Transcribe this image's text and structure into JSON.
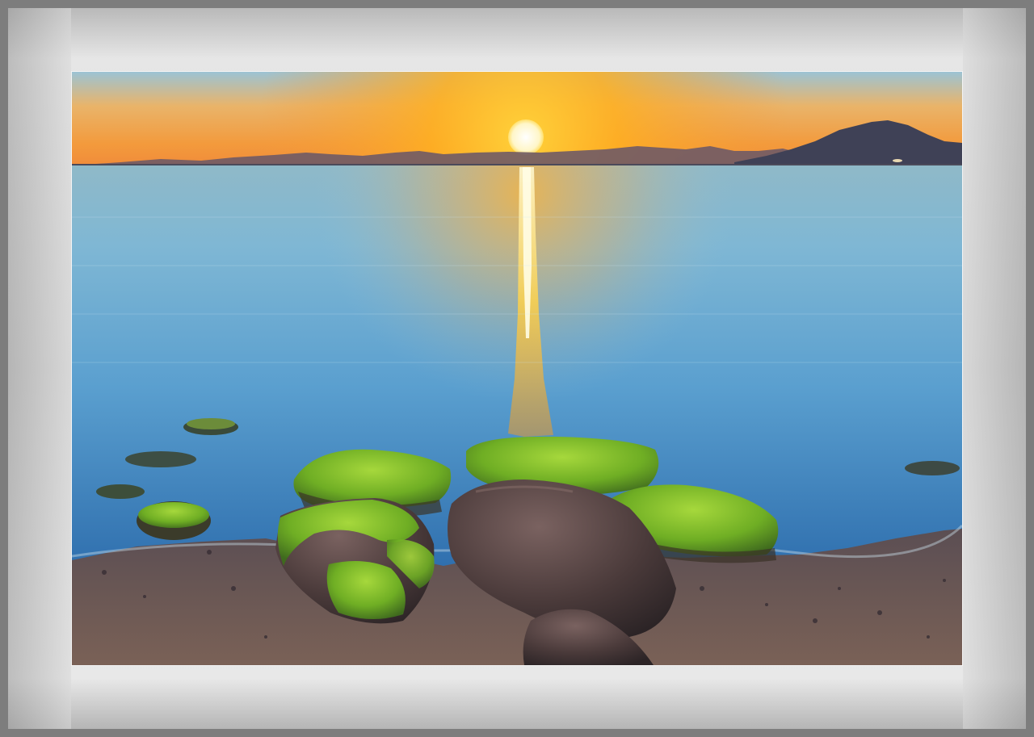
{
  "image": {
    "subject": "sunset-over-sea-with-mossy-rocks",
    "colors": {
      "frame_outer": "#7d7d7d",
      "mat": "#d6d6d6",
      "sky_top": "#8fbad0",
      "sky_glow": "#f7a52a",
      "sun": "#fffbe0",
      "water_light": "#6fb6d8",
      "water_dark": "#2f78b5",
      "moss": "#6fb52a",
      "rock": "#4a3c3a",
      "sand": "#6b5852"
    }
  }
}
